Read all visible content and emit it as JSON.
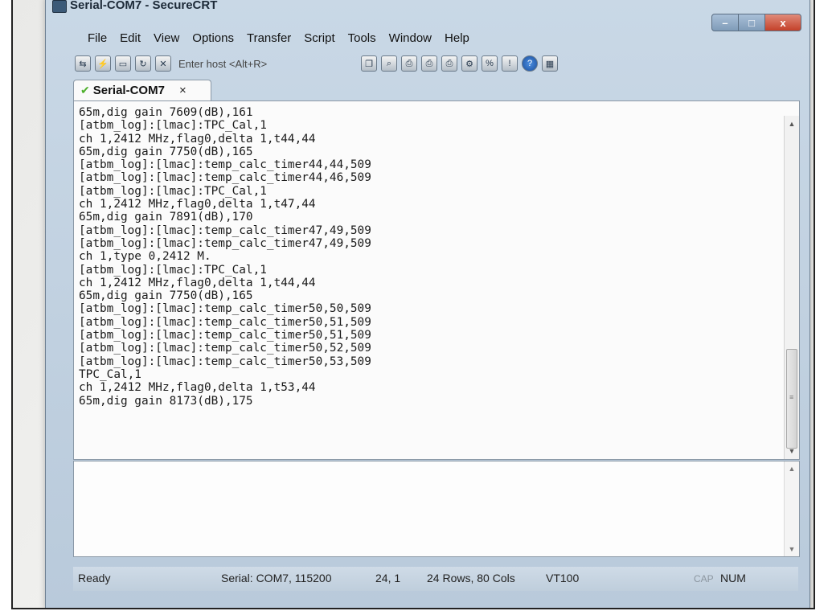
{
  "window": {
    "title": "Serial-COM7 - SecureCRT",
    "controls": {
      "minimize": "–",
      "maximize": "□",
      "close": "x"
    }
  },
  "menu": [
    "File",
    "Edit",
    "View",
    "Options",
    "Transfer",
    "Script",
    "Tools",
    "Window",
    "Help"
  ],
  "toolbar": {
    "left_icons": [
      "connect-icon",
      "quick-connect-icon",
      "connect-tab-icon",
      "reconnect-icon",
      "disconnect-icon"
    ],
    "host_placeholder": "Enter host <Alt+R>",
    "right_icons": [
      "copy-icon",
      "find-icon",
      "print-icon",
      "print-selection-icon",
      "print-screen-icon",
      "session-options-icon",
      "keymap-icon",
      "sftp-icon",
      "help-icon",
      "settings-icon"
    ]
  },
  "tab": {
    "label": "Serial-COM7",
    "close": "×"
  },
  "terminal": {
    "lines": [
      "65m,dig gain 7609(dB),161",
      "[atbm_log]:[lmac]:TPC_Cal,1",
      "ch 1,2412 MHz,flag0,delta 1,t44,44",
      "65m,dig gain 7750(dB),165",
      "[atbm_log]:[lmac]:temp_calc_timer44,44,509",
      "[atbm_log]:[lmac]:temp_calc_timer44,46,509",
      "[atbm_log]:[lmac]:TPC_Cal,1",
      "ch 1,2412 MHz,flag0,delta 1,t47,44",
      "65m,dig gain 7891(dB),170",
      "[atbm_log]:[lmac]:temp_calc_timer47,49,509",
      "[atbm_log]:[lmac]:temp_calc_timer47,49,509",
      "ch 1,type 0,2412 M.",
      "[atbm_log]:[lmac]:TPC_Cal,1",
      "ch 1,2412 MHz,flag0,delta 1,t44,44",
      "65m,dig gain 7750(dB),165",
      "[atbm_log]:[lmac]:temp_calc_timer50,50,509",
      "[atbm_log]:[lmac]:temp_calc_timer50,51,509",
      "[atbm_log]:[lmac]:temp_calc_timer50,51,509",
      "[atbm_log]:[lmac]:temp_calc_timer50,52,509",
      "[atbm_log]:[lmac]:temp_calc_timer50,53,509",
      "TPC_Cal,1",
      "ch 1,2412 MHz,flag0,delta 1,t53,44",
      "65m,dig gain 8173(dB),175"
    ]
  },
  "send_area": {
    "value": ""
  },
  "status": {
    "ready": "Ready",
    "serial": "Serial: COM7, 115200",
    "position": "24,  1",
    "size": "24 Rows, 80 Cols",
    "emulation": "VT100",
    "caps": "CAP",
    "num": "NUM"
  }
}
